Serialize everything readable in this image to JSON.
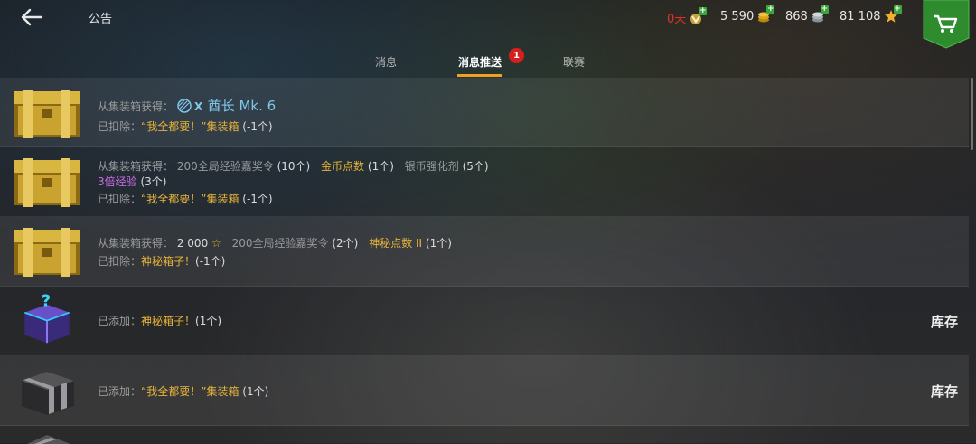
{
  "header": {
    "title": "公告",
    "premium_days": "0天",
    "gold": "5 590",
    "silver": "868",
    "stars": "81 108"
  },
  "tabs": [
    {
      "label": "消息"
    },
    {
      "label": "消息推送"
    },
    {
      "label": "联赛"
    }
  ],
  "notification_badge": "1",
  "messages": [
    {
      "line1_label": "从集装箱获得：",
      "reward_name": "酋长 Mk. 6",
      "line2_label": "已扣除：",
      "line2_item": "“我全都要！”集装箱",
      "line2_count": "(-1个)"
    },
    {
      "line1_label": "从集装箱获得：",
      "r1": "200全局经验嘉奖令",
      "r1c": "(10个)",
      "r2": "金币点数",
      "r2c": "(1个)",
      "r3": "银币强化剂",
      "r3c": "(5个)",
      "r4": "3倍经验",
      "r4c": "(3个)",
      "line3_label": "已扣除：",
      "line3_item": "“我全都要！”集装箱",
      "line3_count": "(-1个)"
    },
    {
      "line1_label": "从集装箱获得：",
      "r1": "2 000",
      "r2": "200全局经验嘉奖令",
      "r2c": "(2个)",
      "r3": "神秘点数 II",
      "r3c": "(1个)",
      "line2_label": "已扣除：",
      "line2_item": "神秘箱子！",
      "line2_count": "(-1个)"
    },
    {
      "label": "已添加：",
      "item": "神秘箱子！",
      "count": "(1个)",
      "action": "库存"
    },
    {
      "label": "已添加：",
      "item": "“我全都要！”集装箱",
      "count": "(1个)",
      "action": "库存"
    }
  ],
  "colors": {
    "accent_gold": "#e8b43a",
    "tab_underline": "#f0a020",
    "badge_red": "#d61f1f",
    "purple_text": "#c86be8",
    "premium_red": "#e0302a",
    "cart_green": "#2e8b2e"
  }
}
